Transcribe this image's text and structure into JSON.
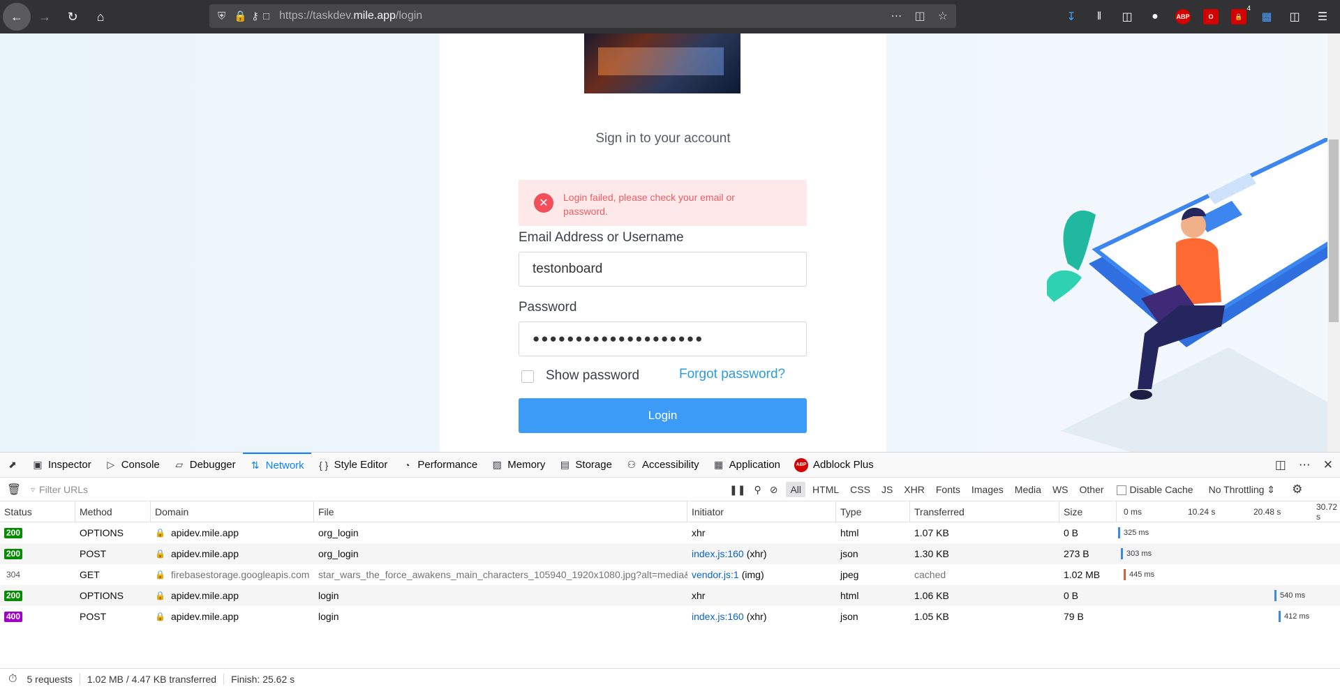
{
  "browser": {
    "url_prefix": "https://taskdev.",
    "url_domain": "mile.app",
    "url_path": "/login",
    "extension_badge_count": "4",
    "abp_label": "ABP"
  },
  "login": {
    "title": "Sign in to your account",
    "error_message": "Login failed, please check your email or password.",
    "email_label": "Email Address or Username",
    "email_value": "testonboard",
    "password_label": "Password",
    "password_masked": "●●●●●●●●●●●●●●●●●●●●",
    "show_password_label": "Show password",
    "forgot_password_label": "Forgot password?",
    "login_button_label": "Login"
  },
  "devtools": {
    "tabs": [
      {
        "label": "Inspector",
        "icon": "inspector-icon"
      },
      {
        "label": "Console",
        "icon": "console-icon"
      },
      {
        "label": "Debugger",
        "icon": "debugger-icon"
      },
      {
        "label": "Network",
        "icon": "network-icon",
        "active": true
      },
      {
        "label": "Style Editor",
        "icon": "style-editor-icon"
      },
      {
        "label": "Performance",
        "icon": "performance-icon"
      },
      {
        "label": "Memory",
        "icon": "memory-icon"
      },
      {
        "label": "Storage",
        "icon": "storage-icon"
      },
      {
        "label": "Accessibility",
        "icon": "accessibility-icon"
      },
      {
        "label": "Application",
        "icon": "application-icon"
      },
      {
        "label": "Adblock Plus",
        "icon": "abp-icon"
      }
    ],
    "filter_placeholder": "Filter URLs",
    "type_filters": [
      "All",
      "HTML",
      "CSS",
      "JS",
      "XHR",
      "Fonts",
      "Images",
      "Media",
      "WS",
      "Other"
    ],
    "disable_cache_label": "Disable Cache",
    "throttling": "No Throttling",
    "columns": [
      "Status",
      "Method",
      "Domain",
      "File",
      "Initiator",
      "Type",
      "Transferred",
      "Size"
    ],
    "waterfall_ticks": [
      "0 ms",
      "10.24 s",
      "20.48 s",
      "30.72 s"
    ],
    "requests": [
      {
        "status": "200",
        "method": "OPTIONS",
        "domain": "apidev.mile.app",
        "file": "org_login",
        "initiator": "xhr",
        "initiator_suffix": "",
        "type": "html",
        "transferred": "1.07 KB",
        "size": "0 B",
        "timing": "325 ms"
      },
      {
        "status": "200",
        "method": "POST",
        "domain": "apidev.mile.app",
        "file": "org_login",
        "initiator": "index.js:160",
        "initiator_suffix": "(xhr)",
        "type": "json",
        "transferred": "1.30 KB",
        "size": "273 B",
        "timing": "303 ms"
      },
      {
        "status": "304",
        "method": "GET",
        "domain": "firebasestorage.googleapis.com",
        "file": "star_wars_the_force_awakens_main_characters_105940_1920x1080.jpg?alt=media&to",
        "initiator": "vendor.js:1",
        "initiator_suffix": "(img)",
        "type": "jpeg",
        "transferred": "cached",
        "size": "1.02 MB",
        "timing": "445 ms"
      },
      {
        "status": "200",
        "method": "OPTIONS",
        "domain": "apidev.mile.app",
        "file": "login",
        "initiator": "xhr",
        "initiator_suffix": "",
        "type": "html",
        "transferred": "1.06 KB",
        "size": "0 B",
        "timing": "540 ms"
      },
      {
        "status": "400",
        "method": "POST",
        "domain": "apidev.mile.app",
        "file": "login",
        "initiator": "index.js:160",
        "initiator_suffix": "(xhr)",
        "type": "json",
        "transferred": "1.05 KB",
        "size": "79 B",
        "timing": "412 ms"
      }
    ],
    "summary": {
      "requests": "5 requests",
      "transferred": "1.02 MB / 4.47 KB transferred",
      "finish": "Finish: 25.62 s"
    }
  }
}
